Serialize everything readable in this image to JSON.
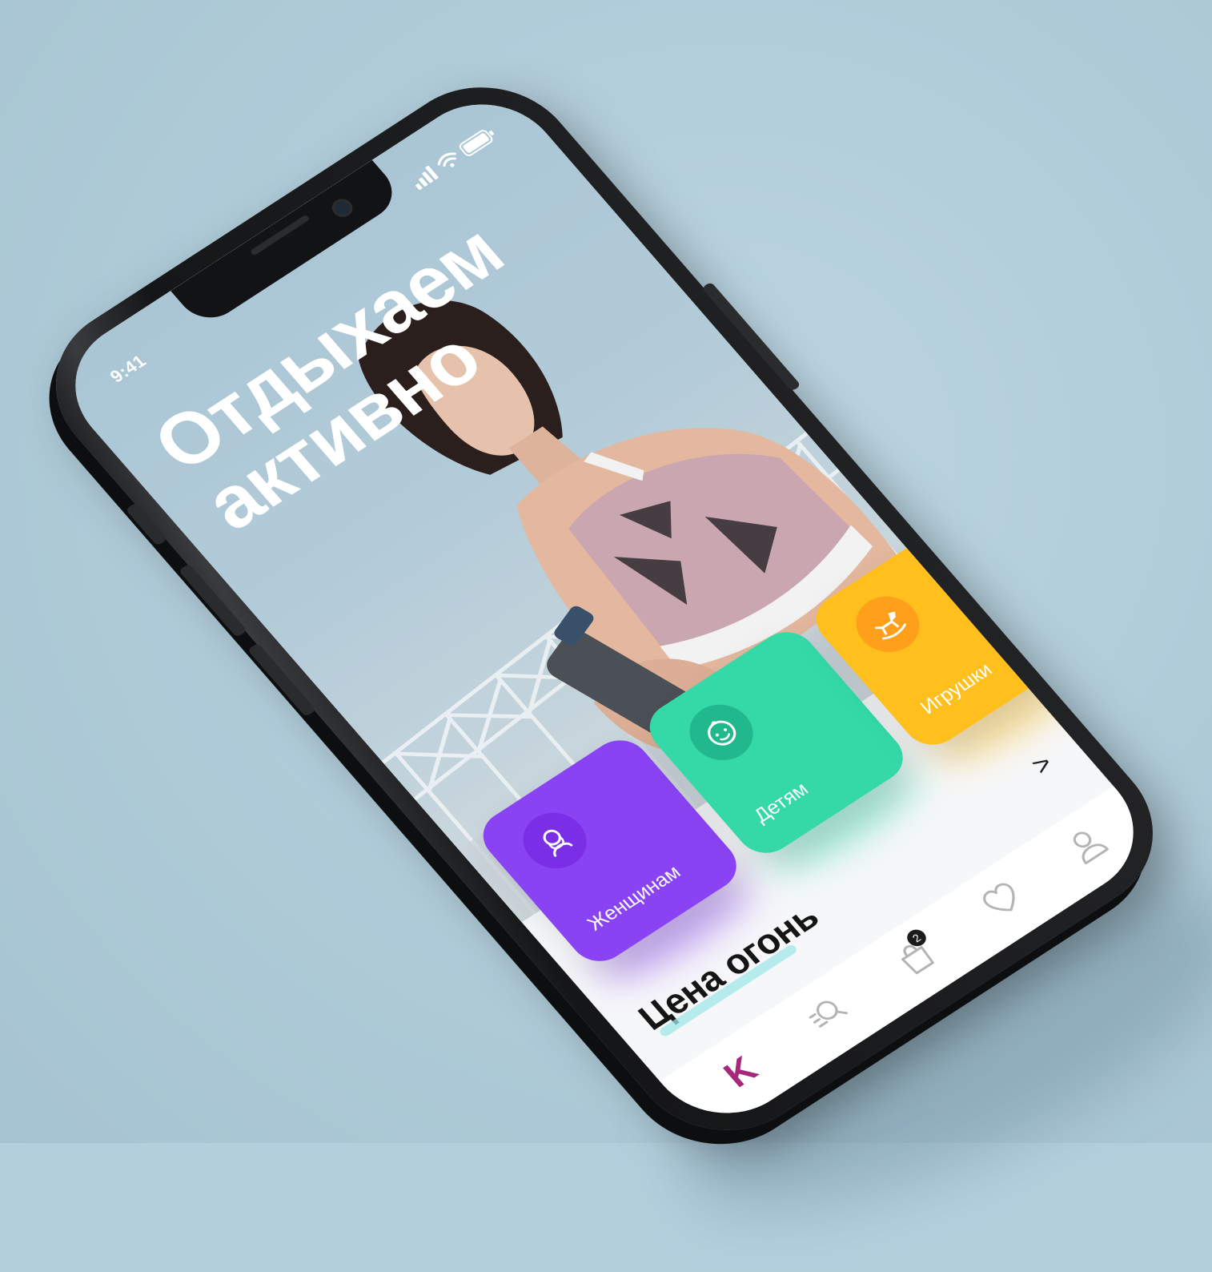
{
  "status_bar": {
    "time": "9:41"
  },
  "hero": {
    "title_line1": "Отдыхаем",
    "title_line2": "активно"
  },
  "categories": [
    {
      "label": "Женщинам",
      "icon": "woman-icon",
      "color": "#8a43f3"
    },
    {
      "label": "Детям",
      "icon": "baby-face-icon",
      "color": "#35d9a8"
    },
    {
      "label": "Игрушки",
      "icon": "rocking-horse-icon",
      "color": "#ffc01e"
    },
    {
      "label": "",
      "icon": "",
      "color": "#45e0e0"
    }
  ],
  "section": {
    "title": "Цена огонь",
    "arrow": ">"
  },
  "tabbar": {
    "logo": "K",
    "logo_color": "#a5287a",
    "cart_count": "2",
    "icons": [
      "logo-icon",
      "search-icon",
      "cart-icon",
      "heart-icon",
      "profile-icon"
    ]
  }
}
